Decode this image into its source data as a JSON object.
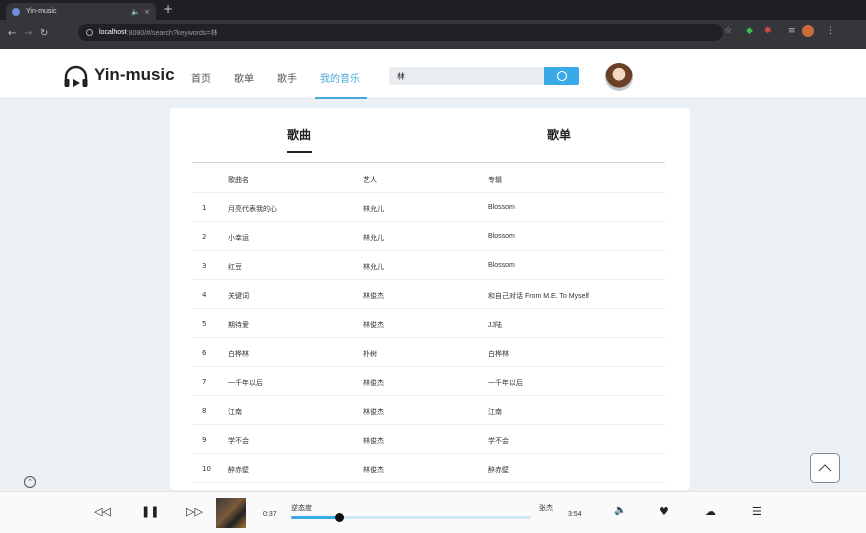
{
  "browser": {
    "tab_title": "Yin-music",
    "tab_mute": "🔈",
    "tab_close": "×",
    "new_tab": "+",
    "url_host": "localhost",
    "url_path": ":8080/#/search?keywords=林"
  },
  "header": {
    "logo": "Yin-music",
    "nav": [
      "首页",
      "歌单",
      "歌手",
      "我的音乐"
    ],
    "active_nav": 3,
    "search_value": "林"
  },
  "result_tabs": {
    "songs": "歌曲",
    "playlists": "歌单"
  },
  "table": {
    "headers": {
      "name": "歌曲名",
      "artist": "艺人",
      "album": "专辑"
    },
    "rows": [
      {
        "idx": "1",
        "name": "月亮代表我的心",
        "artist": "林允儿",
        "album": "Blossom"
      },
      {
        "idx": "2",
        "name": "小幸运",
        "artist": "林允儿",
        "album": "Blossom"
      },
      {
        "idx": "3",
        "name": "红豆",
        "artist": "林允儿",
        "album": "Blossom"
      },
      {
        "idx": "4",
        "name": "关键词",
        "artist": "林俊杰",
        "album": "和自己对话 From M.E. To Myself"
      },
      {
        "idx": "5",
        "name": "期待爱",
        "artist": "林俊杰",
        "album": "JJ陆"
      },
      {
        "idx": "6",
        "name": "白桦林",
        "artist": "朴树",
        "album": "白桦林"
      },
      {
        "idx": "7",
        "name": "一千年以后",
        "artist": "林俊杰",
        "album": "一千年以后"
      },
      {
        "idx": "8",
        "name": "江南",
        "artist": "林俊杰",
        "album": "江南"
      },
      {
        "idx": "9",
        "name": "学不会",
        "artist": "林俊杰",
        "album": "学不会"
      },
      {
        "idx": "10",
        "name": "醉赤壁",
        "artist": "林俊杰",
        "album": "醉赤壁"
      }
    ]
  },
  "player": {
    "current_time": "0:37",
    "total_time": "3:54",
    "song_title": "逆态度",
    "artist": "张杰",
    "progress": 0.2
  },
  "colors": {
    "accent": "#3aa9e8",
    "nav_active": "#48a9d8"
  }
}
